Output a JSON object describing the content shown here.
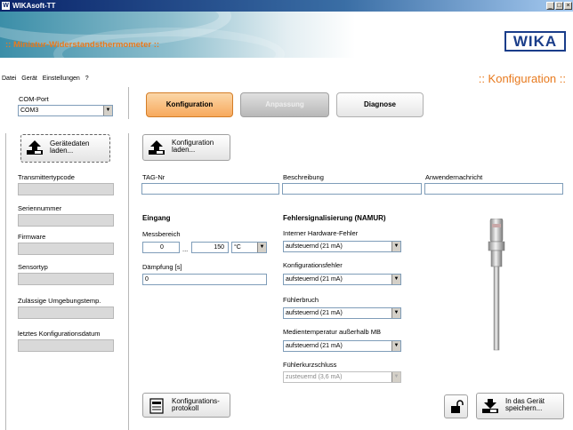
{
  "window": {
    "title": "WIKAsoft-TT",
    "app_icon": "W",
    "min": "_",
    "max": "□",
    "close": "×"
  },
  "banner": {
    "subtitle": ":: Miniatur-Widerstandsthermometer ::",
    "logo": "WIKA"
  },
  "menu": [
    "Datei",
    "Gerät",
    "Einstellungen",
    "?"
  ],
  "page_heading": ":: Konfiguration ::",
  "sidebar": {
    "com_port_label": "COM-Port",
    "com_port_value": "COM3",
    "load_device_button": "Gerätedaten laden...",
    "fields": [
      {
        "label": "Transmittertypcode"
      },
      {
        "label": "Seriennummer"
      },
      {
        "label": "Firmware"
      },
      {
        "label": "Sensortyp"
      },
      {
        "label": "Zulässige Umgebungstemp."
      },
      {
        "label": "letztes Konfigurationsdatum"
      }
    ]
  },
  "tabs": {
    "config": "Konfiguration",
    "adjust": "Anpassung",
    "diagnosis": "Diagnose"
  },
  "load_config_button": "Konfiguration laden...",
  "tag_nr": {
    "label": "TAG-Nr",
    "value": ""
  },
  "description": {
    "label": "Beschreibung",
    "value": ""
  },
  "user_message": {
    "label": "Anwendernachricht",
    "value": ""
  },
  "input": {
    "title": "Eingang",
    "range_label": "Messbereich",
    "range_from": "0",
    "range_sep": "...",
    "range_to": "150",
    "unit": "°C",
    "damping_label": "Dämpfung [s]",
    "damping_value": "0"
  },
  "errors": {
    "title": "Fehlersignalisierung (NAMUR)",
    "items": [
      {
        "label": "Interner Hardware-Fehler",
        "value": "aufsteuernd (21 mA)",
        "enabled": true
      },
      {
        "label": "Konfigurationsfehler",
        "value": "aufsteuernd (21 mA)",
        "enabled": true
      },
      {
        "label": "Fühlerbruch",
        "value": "aufsteuernd (21 mA)",
        "enabled": true
      },
      {
        "label": "Medientemperatur außerhalb MB",
        "value": "aufsteuernd (21 mA)",
        "enabled": true
      },
      {
        "label": "Fühlerkurzschluss",
        "value": "zusteuernd (3,6 mA)",
        "enabled": false
      }
    ]
  },
  "bottom": {
    "protocol_button": "Konfigurations-protokoll",
    "save_button": "In das Gerät speichern..."
  },
  "colors": {
    "accent": "#e87a1e",
    "wika_blue": "#1a3d8a"
  }
}
